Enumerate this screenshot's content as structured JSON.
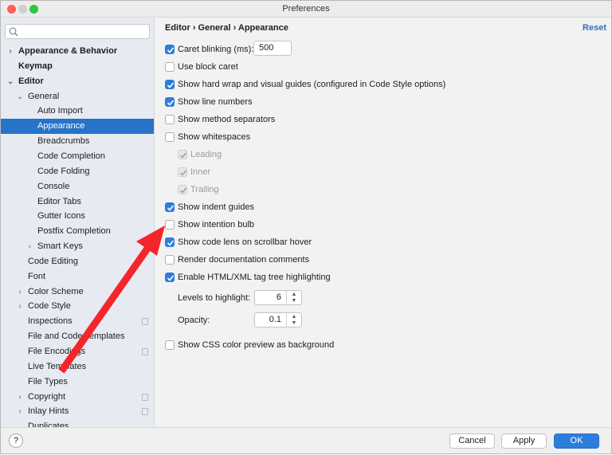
{
  "window": {
    "title": "Preferences"
  },
  "sidebar": {
    "search_placeholder": "",
    "items": [
      {
        "label": "Appearance & Behavior",
        "level": 0,
        "bold": true,
        "chevron": "right"
      },
      {
        "label": "Keymap",
        "level": 0,
        "bold": true
      },
      {
        "label": "Editor",
        "level": 0,
        "bold": true,
        "chevron": "down"
      },
      {
        "label": "General",
        "level": 1,
        "chevron": "down"
      },
      {
        "label": "Auto Import",
        "level": 2
      },
      {
        "label": "Appearance",
        "level": 2,
        "selected": true
      },
      {
        "label": "Breadcrumbs",
        "level": 2
      },
      {
        "label": "Code Completion",
        "level": 2
      },
      {
        "label": "Code Folding",
        "level": 2
      },
      {
        "label": "Console",
        "level": 2
      },
      {
        "label": "Editor Tabs",
        "level": 2
      },
      {
        "label": "Gutter Icons",
        "level": 2
      },
      {
        "label": "Postfix Completion",
        "level": 2
      },
      {
        "label": "Smart Keys",
        "level": 2,
        "chevron": "right"
      },
      {
        "label": "Code Editing",
        "level": 1
      },
      {
        "label": "Font",
        "level": 1
      },
      {
        "label": "Color Scheme",
        "level": 1,
        "chevron": "right"
      },
      {
        "label": "Code Style",
        "level": 1,
        "chevron": "right"
      },
      {
        "label": "Inspections",
        "level": 1,
        "copy": true
      },
      {
        "label": "File and Code Templates",
        "level": 1
      },
      {
        "label": "File Encodings",
        "level": 1,
        "copy": true
      },
      {
        "label": "Live Templates",
        "level": 1
      },
      {
        "label": "File Types",
        "level": 1
      },
      {
        "label": "Copyright",
        "level": 1,
        "chevron": "right",
        "copy": true
      },
      {
        "label": "Inlay Hints",
        "level": 1,
        "chevron": "right",
        "copy": true
      },
      {
        "label": "Duplicates",
        "level": 1
      }
    ]
  },
  "main": {
    "breadcrumb": "Editor  ›  General  ›  Appearance",
    "reset_label": "Reset",
    "options": [
      {
        "label": "Caret blinking (ms):",
        "checked": true,
        "value": "500"
      },
      {
        "label": "Use block caret",
        "checked": false
      },
      {
        "label": "Show hard wrap and visual guides (configured in Code Style options)",
        "checked": true
      },
      {
        "label": "Show line numbers",
        "checked": true
      },
      {
        "label": "Show method separators",
        "checked": false
      },
      {
        "label": "Show whitespaces",
        "checked": false
      },
      {
        "label": "Leading",
        "checked": true,
        "disabled": true,
        "indent": true
      },
      {
        "label": "Inner",
        "checked": true,
        "disabled": true,
        "indent": true
      },
      {
        "label": "Trailing",
        "checked": true,
        "disabled": true,
        "indent": true
      },
      {
        "label": "Show indent guides",
        "checked": true
      },
      {
        "label": "Show intention bulb",
        "checked": false
      },
      {
        "label": "Show code lens on scrollbar hover",
        "checked": true
      },
      {
        "label": "Render documentation comments",
        "checked": false
      },
      {
        "label": "Enable HTML/XML tag tree highlighting",
        "checked": true
      }
    ],
    "levels": {
      "label": "Levels to highlight:",
      "value": "6"
    },
    "opacity": {
      "label": "Opacity:",
      "value": "0.1"
    },
    "css_preview": {
      "label": "Show CSS color preview as background",
      "checked": false
    }
  },
  "footer": {
    "help_label": "?",
    "cancel_label": "Cancel",
    "apply_label": "Apply",
    "ok_label": "OK"
  },
  "annotation": {
    "type": "arrow",
    "color": "#f5262b",
    "points_to": "Show intention bulb"
  }
}
